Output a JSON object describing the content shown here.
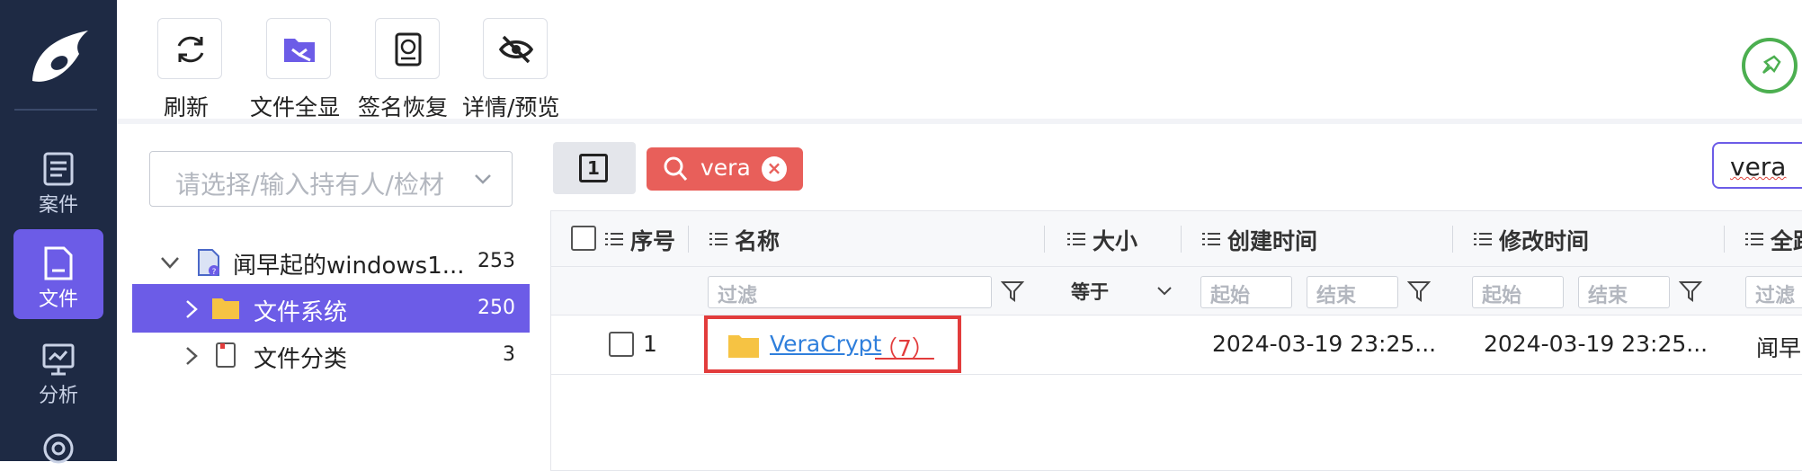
{
  "sidebar": {
    "items": [
      {
        "label": "案件",
        "icon": "document-list-icon"
      },
      {
        "label": "文件",
        "icon": "file-icon",
        "active": true
      },
      {
        "label": "分析",
        "icon": "monitor-chart-icon"
      }
    ]
  },
  "toolbar": {
    "buttons": [
      {
        "label": "刷新",
        "icon": "refresh-icon"
      },
      {
        "label": "文件全显",
        "icon": "folder-expand-icon"
      },
      {
        "label": "签名恢复",
        "icon": "disk-restore-icon"
      },
      {
        "label": "详情/预览",
        "icon": "eye-off-icon"
      }
    ]
  },
  "tree": {
    "select_placeholder": "请选择/输入持有人/检材",
    "nodes": [
      {
        "label": "闻早起的windows1...",
        "count": "253"
      },
      {
        "label": "文件系统",
        "count": "250"
      },
      {
        "label": "文件分类",
        "count": "3"
      }
    ]
  },
  "content": {
    "page_indicator": "1",
    "search_tag": "vera",
    "search_value": "vera",
    "columns": [
      "序号",
      "名称",
      "大小",
      "创建时间",
      "修改时间",
      "全路"
    ],
    "filter": {
      "name_placeholder": "过滤",
      "size_op": "等于",
      "start": "起始",
      "end": "结束",
      "path_placeholder": "过滤"
    },
    "rows": [
      {
        "index": "1",
        "name": "VeraCrypt",
        "child_count": "（7）",
        "created": "2024-03-19 23:25...",
        "modified": "2024-03-19 23:25...",
        "path": "闻早"
      }
    ]
  },
  "colors": {
    "accent": "#6c5ce7",
    "rail": "#1e2a44",
    "tag": "#e85f5a",
    "highlight": "#e23c3c"
  }
}
